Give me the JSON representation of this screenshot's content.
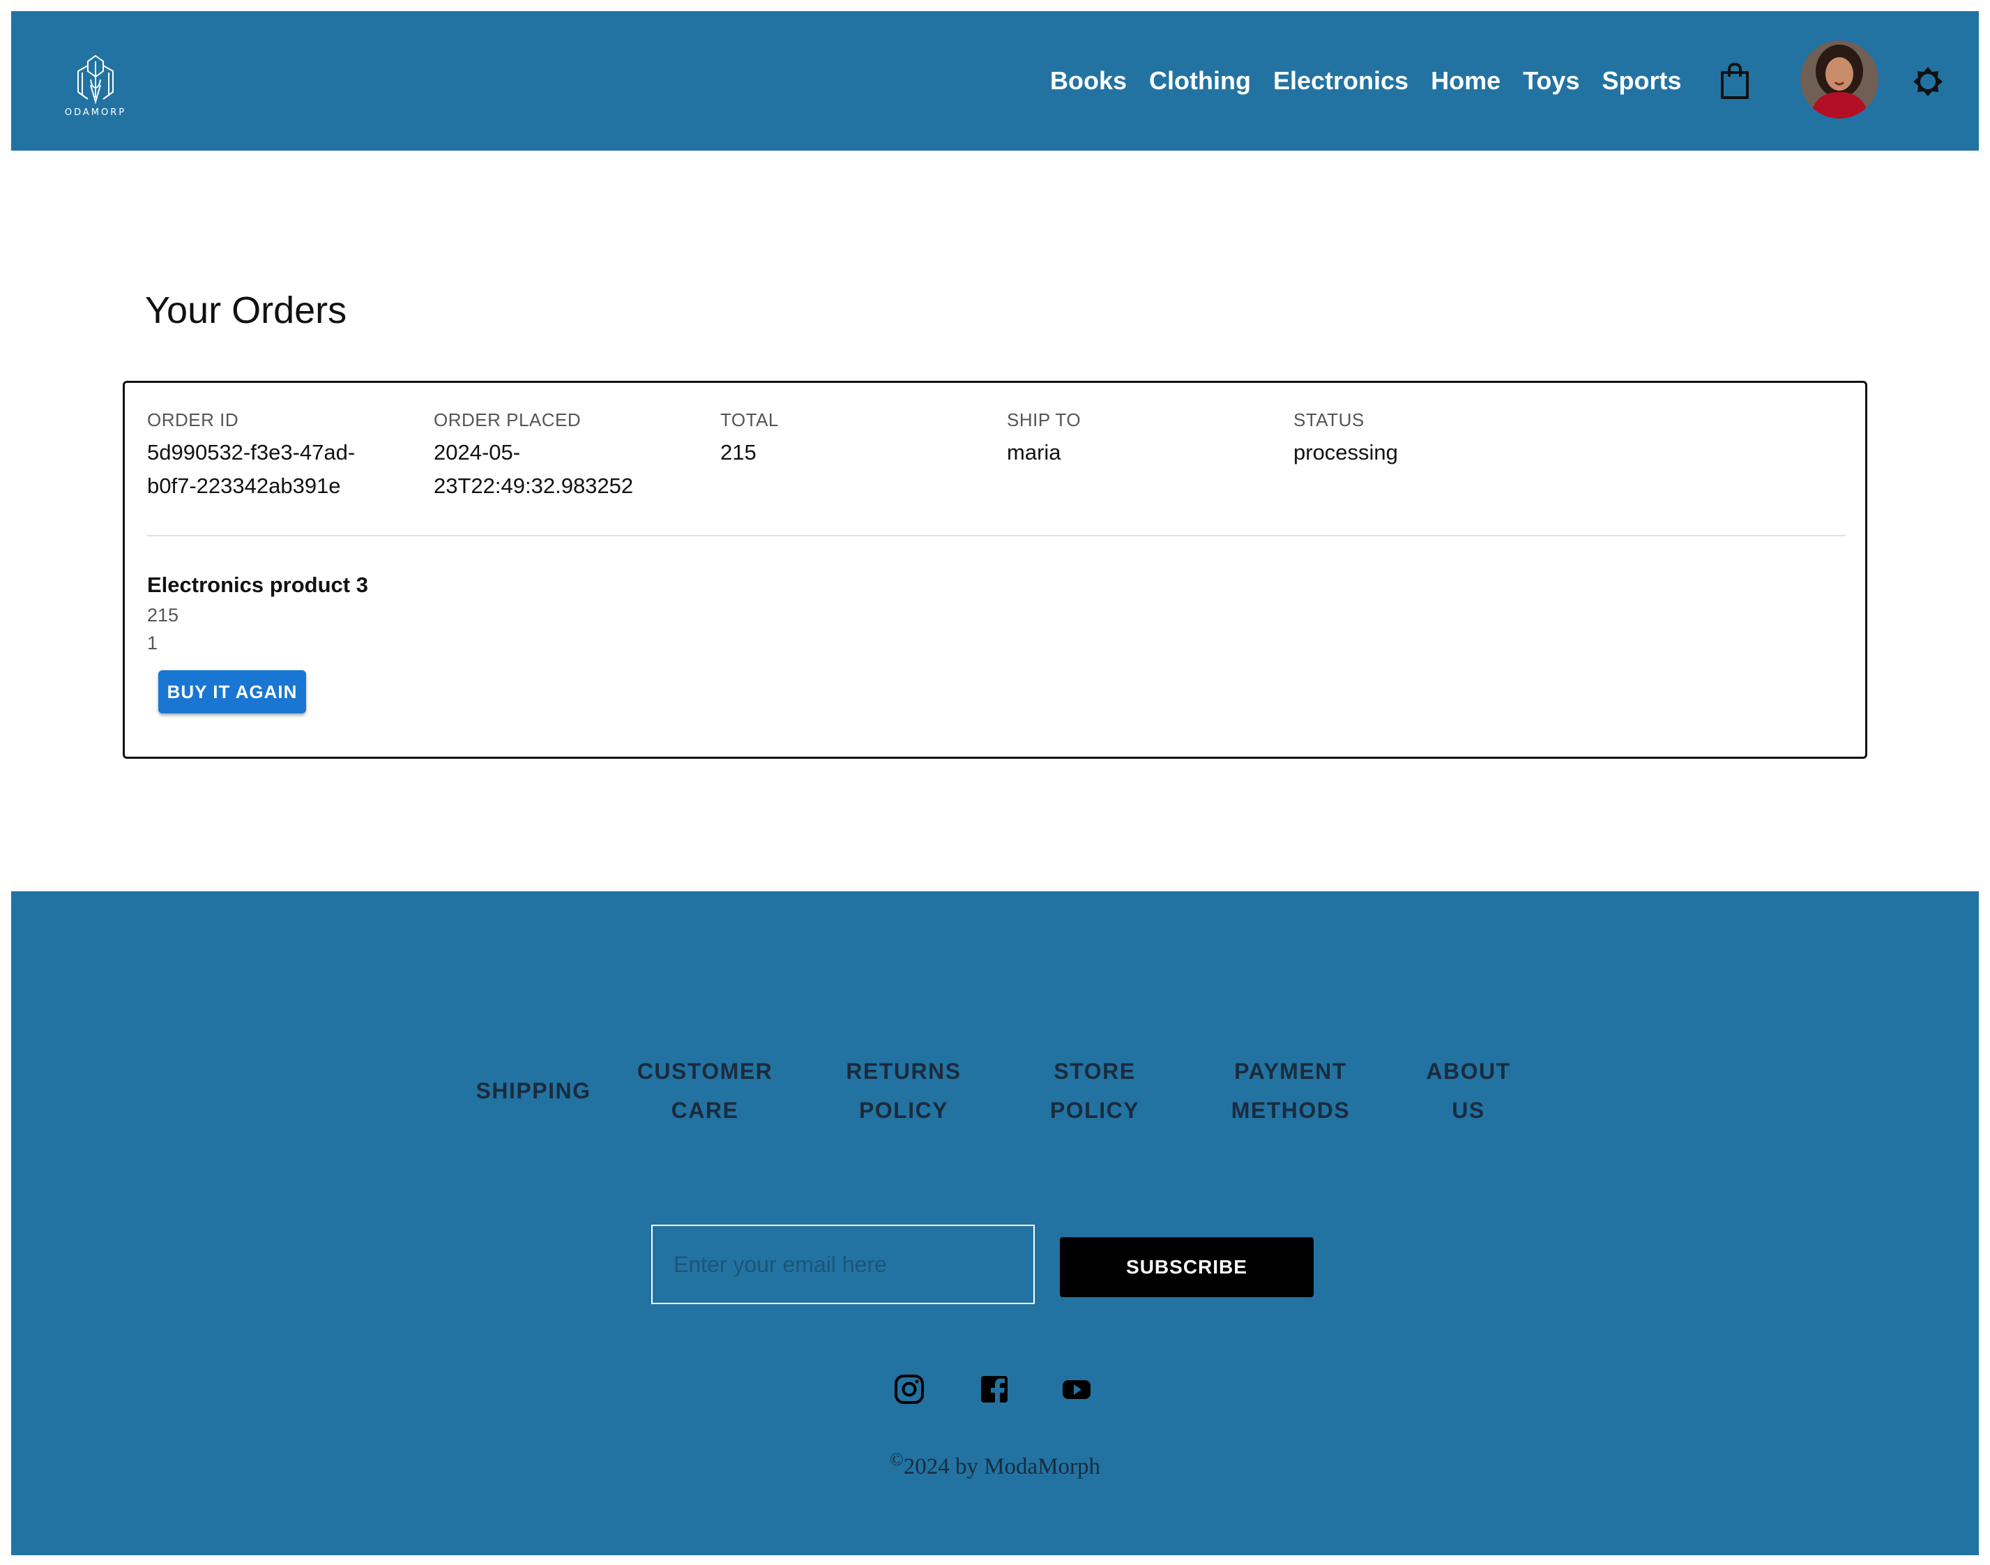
{
  "header": {
    "logo_text": "ODAMORP",
    "nav": [
      "Books",
      "Clothing",
      "Electronics",
      "Home",
      "Toys",
      "Sports"
    ],
    "icons": {
      "cart": "shopping-bag-icon",
      "avatar": "user-avatar",
      "theme": "theme-toggle-icon"
    }
  },
  "main": {
    "title": "Your Orders",
    "order": {
      "labels": {
        "id": "Order ID",
        "placed": "Order Placed",
        "total": "Total",
        "ship_to": "Ship To",
        "status": "Status"
      },
      "id_line1": "5d990532-f3e3-47ad-",
      "id_line2": "b0f7-223342ab391e",
      "placed_line1": "2024-05-",
      "placed_line2": "23T22:49:32.983252",
      "total": "215",
      "ship_to": "maria",
      "status": "processing",
      "item": {
        "name": "Electronics product 3",
        "price": "215",
        "quantity": "1",
        "buy_again_label": "Buy it again"
      }
    }
  },
  "footer": {
    "links": [
      {
        "line1": "Shipping",
        "line2": ""
      },
      {
        "line1": "Customer",
        "line2": "Care"
      },
      {
        "line1": "Returns",
        "line2": "Policy"
      },
      {
        "line1": "Store",
        "line2": "Policy"
      },
      {
        "line1": "Payment",
        "line2": "Methods"
      },
      {
        "line1": "About",
        "line2": "Us"
      }
    ],
    "email_placeholder": "Enter your email here",
    "subscribe_label": "SUBSCRIBE",
    "social": [
      "instagram-icon",
      "facebook-icon",
      "youtube-icon"
    ],
    "copyright": "2024 by ModaMorph"
  },
  "colors": {
    "brand": "#2273a2",
    "button": "#1976d2",
    "footer_text": "#1b2b3c"
  }
}
